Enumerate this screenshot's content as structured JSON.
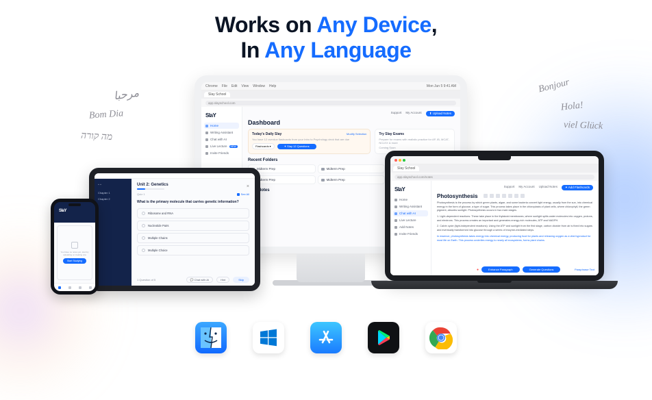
{
  "headline": {
    "prefix1": "Works on ",
    "accent1": "Any Device",
    "comma": ",",
    "prefix2": "In ",
    "accent2": "Any Language"
  },
  "greetings": {
    "arabic": "مرحبا",
    "portuguese": "Bom Dia",
    "hebrew": "מה קורה",
    "french": "Bonjour",
    "spanish": "Hola!",
    "german": "viel Glück"
  },
  "imac": {
    "menubar": [
      "Chrome",
      "File",
      "Edit",
      "View",
      "Window",
      "Help"
    ],
    "clock": "Mon Jun 5  9:41 AM",
    "tab": "Slay School",
    "url": "app.slayschool.com",
    "logo": "SlaY",
    "sidebar": [
      {
        "label": "Home",
        "active": true
      },
      {
        "label": "Writing Assistant"
      },
      {
        "label": "Chat with AI"
      },
      {
        "label": "Live Lecture",
        "badge": "NEW"
      },
      {
        "label": "Invite Friends"
      }
    ],
    "topbar": {
      "support": "Support",
      "account": "My Account",
      "upload": "Upload Notes"
    },
    "title": "Dashboard",
    "daily": {
      "title": "Today's Daily Slay",
      "desc": "You have 12 overdue flashcards from your Intro to Psychology deck that are due",
      "modify": "Modify Selection",
      "pill": "Flashcards",
      "button": "Slay 12 Questions"
    },
    "exams": {
      "title": "Try Slay Exams",
      "desc": "Prepare for exams with realistic practice for AP, IB, MCAT, NCLEX & more",
      "extra": "Coming Soon"
    },
    "folders_h": "Recent Folders",
    "folders": [
      "Midterm Prep",
      "Midterm Prep",
      "Midterm Prep",
      "Midterm Prep",
      "Midterm Prep",
      "Midterm Prep"
    ],
    "notes_h": "Your Notes"
  },
  "macbook": {
    "tab": "Slay School",
    "url": "app.slayschool.com/notes",
    "logo": "SlaY",
    "sidebar": [
      {
        "label": "Home"
      },
      {
        "label": "Writing Assistant"
      },
      {
        "label": "Chat with AI",
        "active": true
      },
      {
        "label": "Live Lecture"
      },
      {
        "label": "Add Notes"
      },
      {
        "label": "Invite Friends"
      }
    ],
    "topbar": {
      "support": "Support",
      "account": "My Account",
      "upload": "Upload Notes",
      "addfc": "Add Flashcards"
    },
    "doc_title": "Photosynthesis",
    "para1": "Photosynthesis is the process by which green plants, algae, and some bacteria convert light energy, usually from the sun, into chemical energy in the form of glucose, a type of sugar. This process takes place in the chloroplasts of plant cells, where chlorophyll, the green pigment, absorbs sunlight. Photosynthesis occurs in two main stages.",
    "para2": "1. Light-dependent reactions: These take place in the thylakoid membranes, where sunlight splits water molecules into oxygen, protons, and electrons. This process creates an important and generates energy-rich molecules, ATP and NADPH.",
    "para3": "2. Calvin cycle (light-independent reactions): Using the ATP and sunlight from the first stage, carbon dioxide from air is fixed into sugars and eventually transformed into glucose through a series of enzyme-mediated steps.",
    "para4": "In essence, photosynthesis takes energy into chemical energy, producing food for plants and releasing oxygen as a vital byproduct for most life on Earth. This process underlies energy to nearly all ecosystems, forms plant chains.",
    "btn1": "Enhance Paragraph",
    "btn2": "Generate Questions",
    "link": "Paraphrase Text"
  },
  "ipad": {
    "nav": [
      "Chapter 1",
      "Chapter 2"
    ],
    "title": "Unit 2: Genetics",
    "tag": "Quiz 1",
    "seeall": "See All",
    "question": "What is the primary molecule that carries genetic information?",
    "options": [
      "Ribosome and RNA",
      "Nucleotide Pairs",
      "Multiple Chains",
      "Multiple Choice"
    ],
    "counter": "1 Question of 5",
    "chat": "Chat with AI",
    "hint": "Hint",
    "skip": "Skip"
  },
  "iphone": {
    "logo": "SlaY",
    "card_text": "You have no notes yet, start by uploading or creating one",
    "start": "Start Studying"
  },
  "platforms": [
    "macos",
    "windows",
    "appstore",
    "playstore",
    "chrome"
  ]
}
